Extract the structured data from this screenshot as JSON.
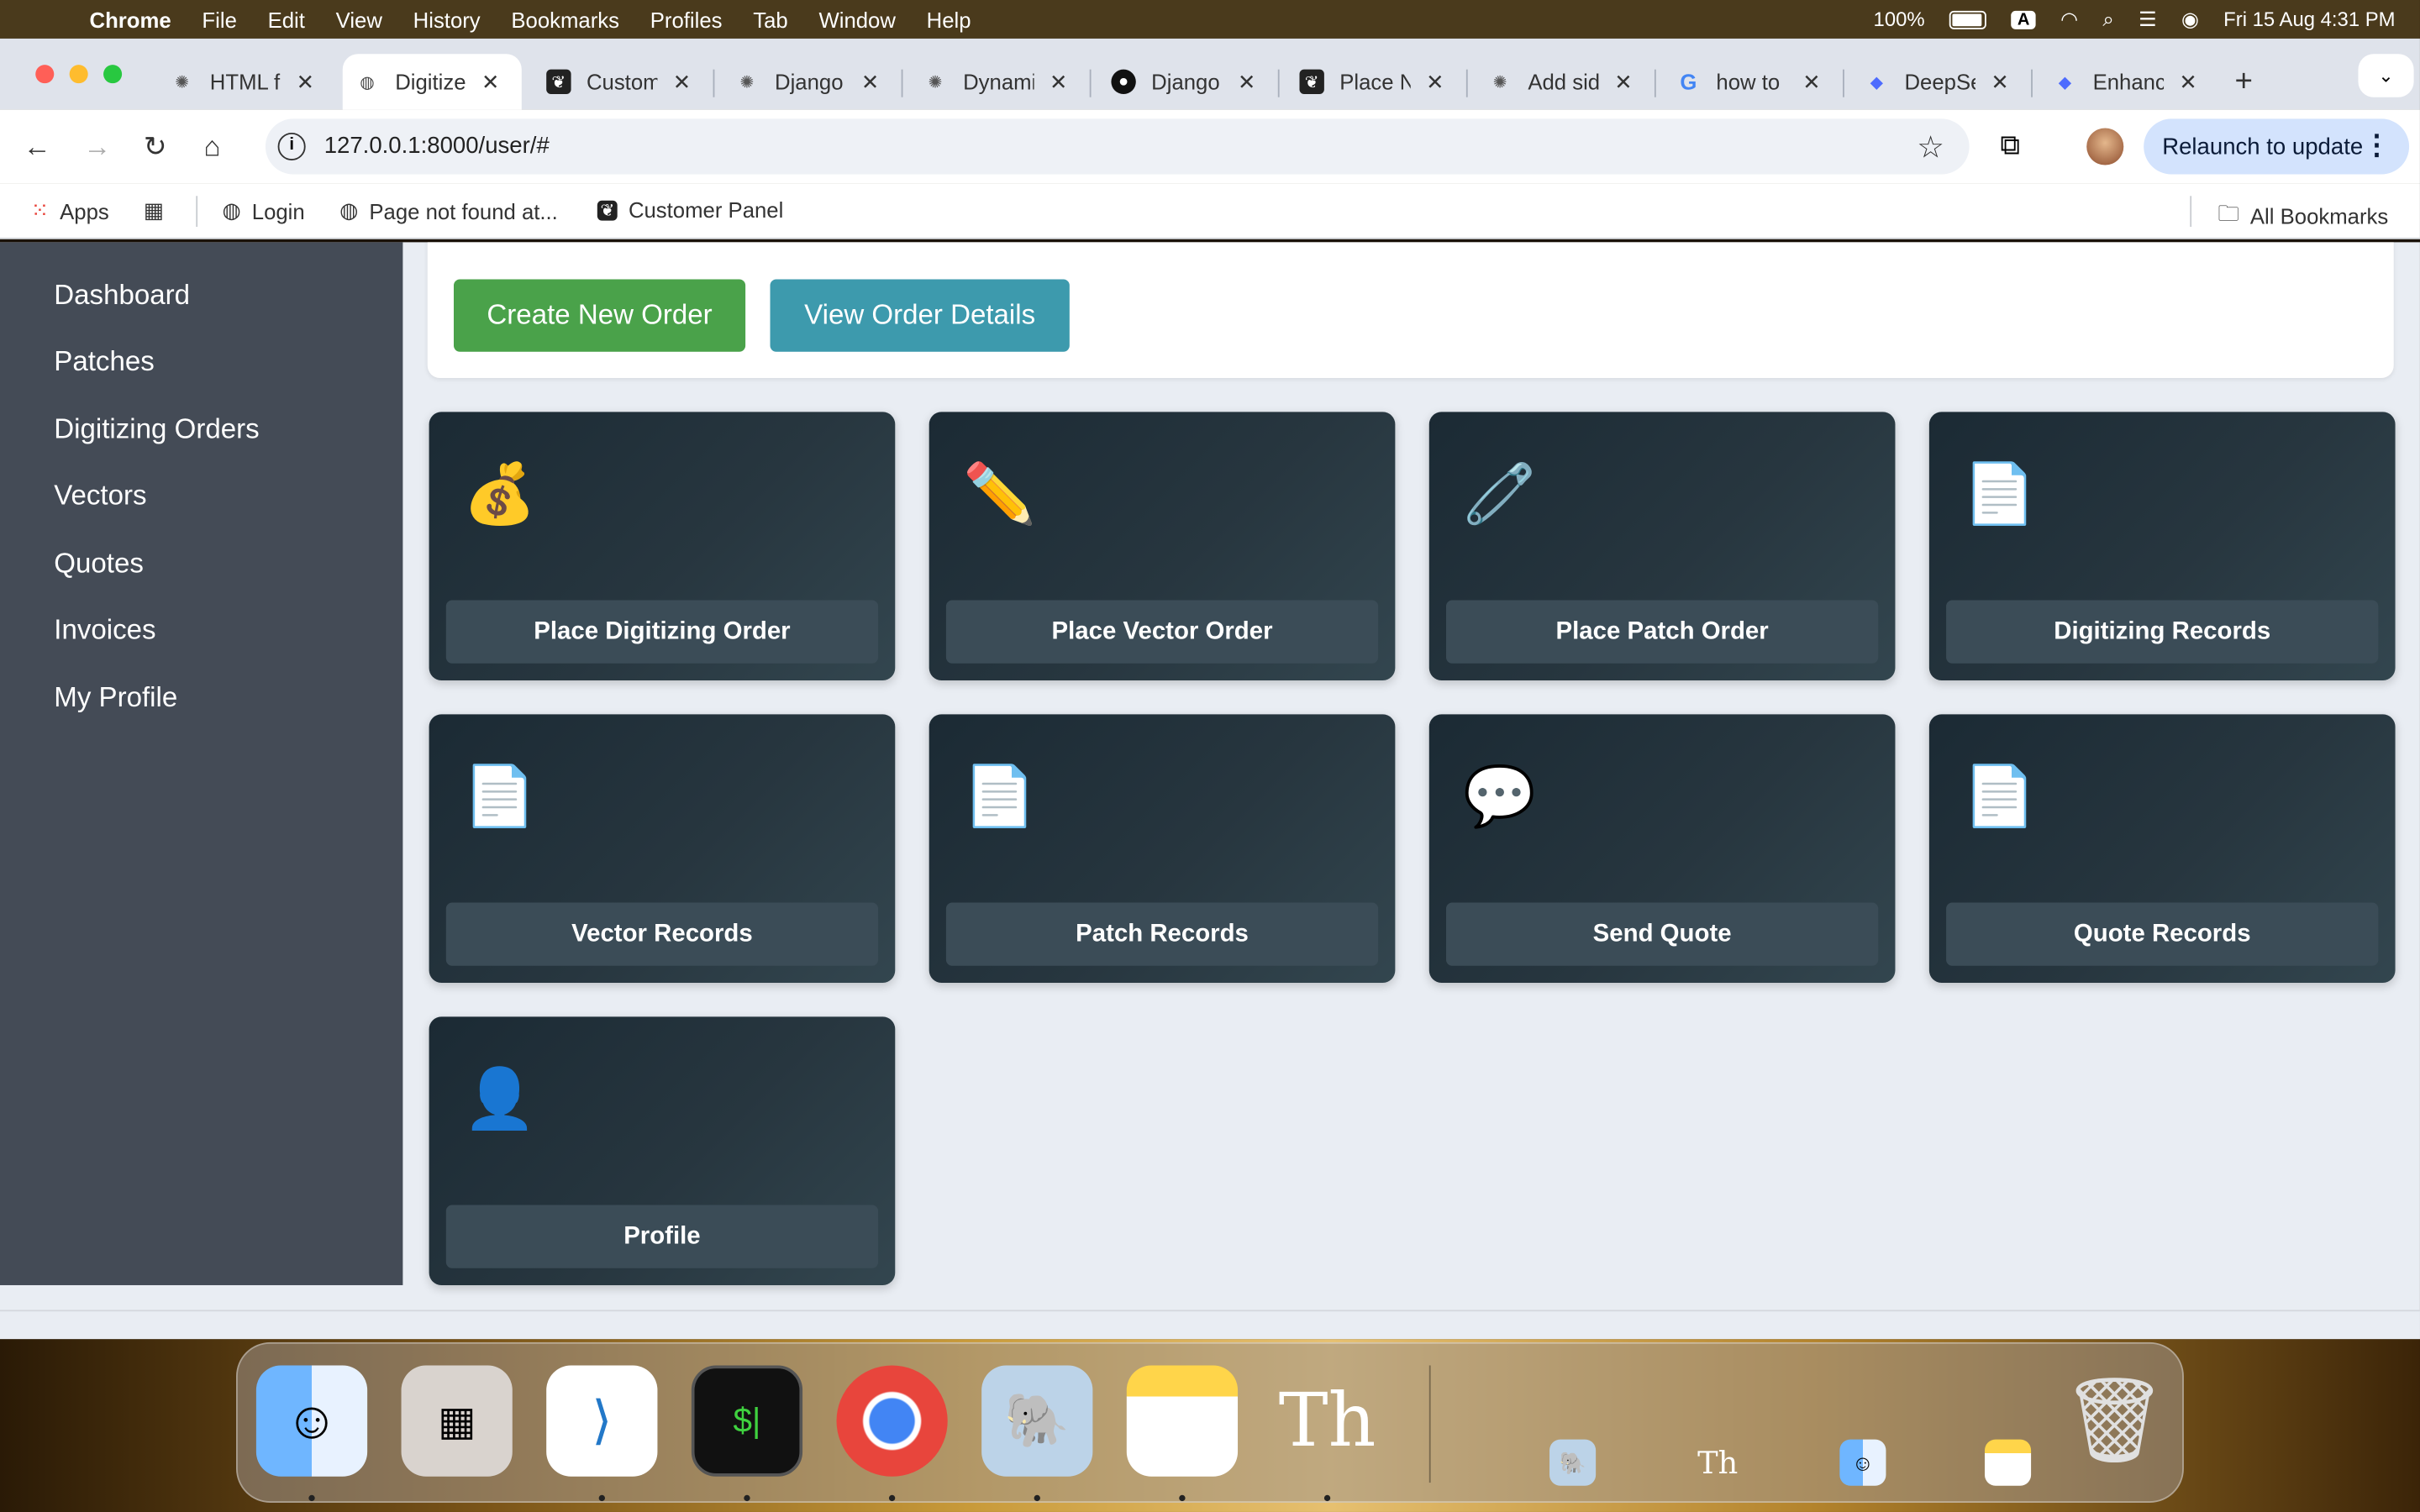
{
  "menubar": {
    "app": "Chrome",
    "items": [
      "File",
      "Edit",
      "View",
      "History",
      "Bookmarks",
      "Profiles",
      "Tab",
      "Window",
      "Help"
    ],
    "battery": "100%",
    "input_source": "A",
    "datetime": "Fri 15 Aug  4:31 PM"
  },
  "tabs": [
    {
      "title": "HTML f",
      "icon": "openai-icon"
    },
    {
      "title": "Digitize",
      "icon": "globe-icon",
      "active": true
    },
    {
      "title": "Custom",
      "icon": "leaf-icon"
    },
    {
      "title": "Django",
      "icon": "openai-icon"
    },
    {
      "title": "Dynami",
      "icon": "openai-icon"
    },
    {
      "title": "Django",
      "icon": "github-icon"
    },
    {
      "title": "Place N",
      "icon": "leaf-icon"
    },
    {
      "title": "Add sid",
      "icon": "openai-icon"
    },
    {
      "title": "how to",
      "icon": "google-icon"
    },
    {
      "title": "DeepSe",
      "icon": "deepseek-icon"
    },
    {
      "title": "Enhanc",
      "icon": "deepseek-icon"
    }
  ],
  "toolbar": {
    "url": "127.0.0.1:8000/user/#",
    "relaunch_label": "Relaunch to update"
  },
  "bookmarks": {
    "items": [
      {
        "label": "Apps"
      },
      {
        "label": "Login"
      },
      {
        "label": "Page not found at..."
      },
      {
        "label": "Customer Panel"
      }
    ],
    "all_bookmarks": "All Bookmarks"
  },
  "sidebar": {
    "items": [
      "Dashboard",
      "Patches",
      "Digitizing Orders",
      "Vectors",
      "Quotes",
      "Invoices",
      "My Profile"
    ]
  },
  "actions": {
    "create_order": "Create New Order",
    "view_order": "View Order Details"
  },
  "tiles": [
    {
      "label": "Place Digitizing Order",
      "emoji": "💰",
      "icon": "money-bag-icon"
    },
    {
      "label": "Place Vector Order",
      "emoji": "✏️",
      "icon": "pencil-icon"
    },
    {
      "label": "Place Patch Order",
      "emoji": "🧷",
      "icon": "safety-pin-icon"
    },
    {
      "label": "Digitizing Records",
      "emoji": "📄",
      "icon": "document-icon"
    },
    {
      "label": "Vector Records",
      "emoji": "📄",
      "icon": "document-icon"
    },
    {
      "label": "Patch Records",
      "emoji": "📄",
      "icon": "document-icon"
    },
    {
      "label": "Send Quote",
      "emoji": "💬",
      "icon": "speech-bubble-icon"
    },
    {
      "label": "Quote Records",
      "emoji": "📄",
      "icon": "document-icon"
    },
    {
      "label": "Profile",
      "emoji": "👤",
      "icon": "user-icon"
    }
  ],
  "dock": {
    "apps": [
      "Finder",
      "Launchpad",
      "Visual Studio Code",
      "Terminal",
      "Google Chrome",
      "pgAdmin",
      "Notes",
      "Typora"
    ]
  },
  "colors": {
    "sidebar_bg": "#444b56",
    "green_button": "#4aa24a",
    "teal_button": "#3d9aad",
    "tile_bg": "#1b2a34",
    "page_bg": "#e9edf3"
  }
}
